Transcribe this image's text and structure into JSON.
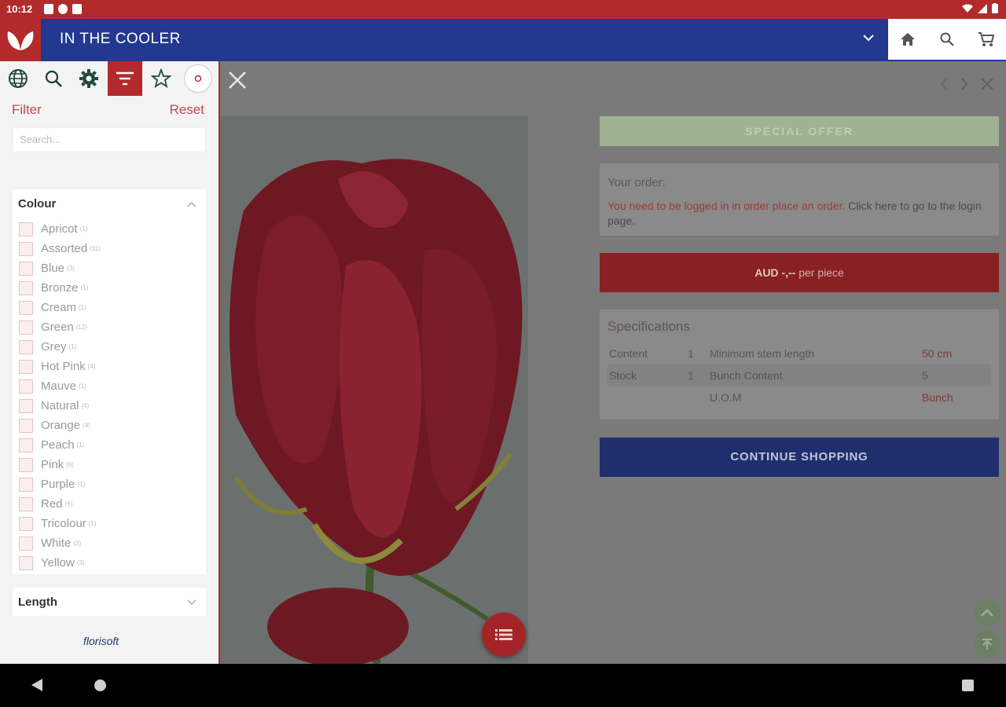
{
  "status": {
    "time": "10:12"
  },
  "appbar": {
    "title": "IN THE COOLER"
  },
  "sidebar": {
    "filter_label": "Filter",
    "reset_label": "Reset",
    "search_placeholder": "Search...",
    "colour": {
      "title": "Colour",
      "items": [
        {
          "label": "Apricot",
          "count": "(1)"
        },
        {
          "label": "Assorted",
          "count": "(11)"
        },
        {
          "label": "Blue",
          "count": "(3)"
        },
        {
          "label": "Bronze",
          "count": "(1)"
        },
        {
          "label": "Cream",
          "count": "(1)"
        },
        {
          "label": "Green",
          "count": "(12)"
        },
        {
          "label": "Grey",
          "count": "(1)"
        },
        {
          "label": "Hot Pink",
          "count": "(4)"
        },
        {
          "label": "Mauve",
          "count": "(1)"
        },
        {
          "label": "Natural",
          "count": "(4)"
        },
        {
          "label": "Orange",
          "count": "(4)"
        },
        {
          "label": "Peach",
          "count": "(1)"
        },
        {
          "label": "Pink",
          "count": "(6)"
        },
        {
          "label": "Purple",
          "count": "(1)"
        },
        {
          "label": "Red",
          "count": "(6)"
        },
        {
          "label": "Tricolour",
          "count": "(1)"
        },
        {
          "label": "White",
          "count": "(3)"
        },
        {
          "label": "Yellow",
          "count": "(3)"
        }
      ]
    },
    "length": {
      "title": "Length"
    },
    "brand": {
      "part1": "flori",
      "part2": "soft"
    }
  },
  "product": {
    "special_offer": "SPECIAL OFFER",
    "order_title": "Your order:",
    "order_warning": "You need to be logged in in order place an order.",
    "order_link": "Click here to go to the login page.",
    "price_prefix": "AUD -,--",
    "price_suffix": "per piece",
    "specs_title": "Specifications",
    "specs": [
      {
        "k1": "Content",
        "v1": "1",
        "k2": "Minimum stem length",
        "v2": "50 cm"
      },
      {
        "k1": "Stock",
        "v1": "1",
        "k2": "Bunch Content",
        "v2": "5"
      },
      {
        "k1": "",
        "v1": "",
        "k2": "U.O.M",
        "v2": "Bunch"
      }
    ],
    "continue_label": "CONTINUE SHOPPING"
  },
  "colors": {
    "brand_red": "#b22a2c",
    "brand_blue": "#23388f",
    "offer_green": "#9fb291"
  }
}
